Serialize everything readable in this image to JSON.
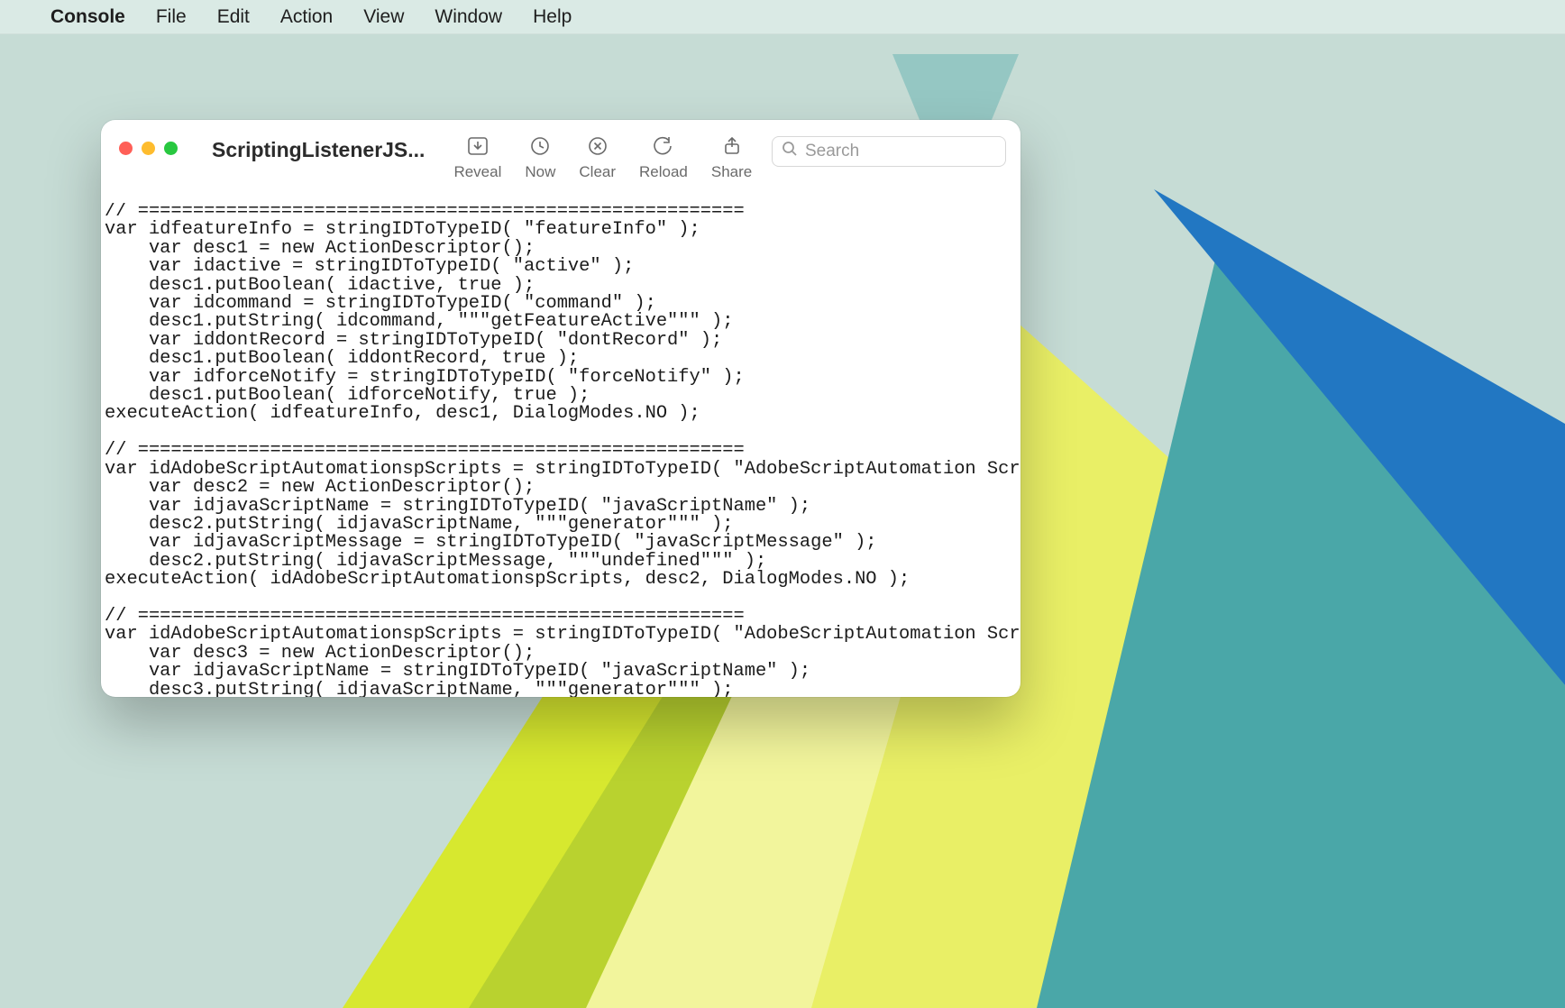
{
  "menubar": {
    "app": "Console",
    "items": [
      "File",
      "Edit",
      "Action",
      "View",
      "Window",
      "Help"
    ]
  },
  "window": {
    "title": "ScriptingListenerJS...",
    "toolbar": {
      "reveal": "Reveal",
      "now": "Now",
      "clear": "Clear",
      "reload": "Reload",
      "share": "Share"
    },
    "search_placeholder": "Search"
  },
  "log_text": "// =======================================================\nvar idfeatureInfo = stringIDToTypeID( \"featureInfo\" );\n    var desc1 = new ActionDescriptor();\n    var idactive = stringIDToTypeID( \"active\" );\n    desc1.putBoolean( idactive, true );\n    var idcommand = stringIDToTypeID( \"command\" );\n    desc1.putString( idcommand, \"\"\"getFeatureActive\"\"\" );\n    var iddontRecord = stringIDToTypeID( \"dontRecord\" );\n    desc1.putBoolean( iddontRecord, true );\n    var idforceNotify = stringIDToTypeID( \"forceNotify\" );\n    desc1.putBoolean( idforceNotify, true );\nexecuteAction( idfeatureInfo, desc1, DialogModes.NO );\n\n// =======================================================\nvar idAdobeScriptAutomationspScripts = stringIDToTypeID( \"AdobeScriptAutomation Scripts\" );\n    var desc2 = new ActionDescriptor();\n    var idjavaScriptName = stringIDToTypeID( \"javaScriptName\" );\n    desc2.putString( idjavaScriptName, \"\"\"generator\"\"\" );\n    var idjavaScriptMessage = stringIDToTypeID( \"javaScriptMessage\" );\n    desc2.putString( idjavaScriptMessage, \"\"\"undefined\"\"\" );\nexecuteAction( idAdobeScriptAutomationspScripts, desc2, DialogModes.NO );\n\n// =======================================================\nvar idAdobeScriptAutomationspScripts = stringIDToTypeID( \"AdobeScriptAutomation Scripts\" );\n    var desc3 = new ActionDescriptor();\n    var idjavaScriptName = stringIDToTypeID( \"javaScriptName\" );\n    desc3.putString( idjavaScriptName, \"\"\"generator\"\"\" );"
}
